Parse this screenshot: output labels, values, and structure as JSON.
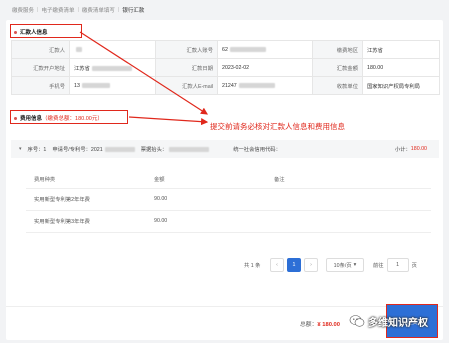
{
  "breadcrumb": [
    "缴费服务",
    "电子缴费清单",
    "缴费清单填写",
    "银行汇款"
  ],
  "remitter_section": {
    "title": "汇款人信息"
  },
  "remitter_rows": [
    [
      {
        "label": "汇款人",
        "value": ""
      },
      {
        "label": "汇款人账号",
        "value": "62"
      },
      {
        "label": "缴费地区",
        "value": "江苏省"
      }
    ],
    [
      {
        "label": "汇款开户地址",
        "value": "江苏省"
      },
      {
        "label": "汇款日期",
        "value": "2023-02-02"
      },
      {
        "label": "汇款金额",
        "value": "180.00"
      }
    ],
    [
      {
        "label": "手机号",
        "value": "13"
      },
      {
        "label": "汇款人E-mail",
        "value": "21247"
      },
      {
        "label": "收款单位",
        "value": "国家知识产权局专利局"
      }
    ]
  ],
  "fee_section": {
    "title": "费用信息",
    "total_note": "（缴费总额：180.00元）"
  },
  "annotation": "提交前请务必核对汇款人信息和费用信息",
  "item": {
    "caret": "▾",
    "seq": "序号：1",
    "app_no": "申请号/专利号：2021",
    "payer_label": "票据抬头：",
    "credit_code_label": "统一社会信用代码：",
    "subtotal_label": "小计：",
    "subtotal_value": "180.00"
  },
  "fee_table": {
    "headers": [
      "费用种类",
      "金额",
      "备注"
    ],
    "rows": [
      {
        "kind": "实用新型专利第2年年费",
        "amount": "90.00",
        "note": ""
      },
      {
        "kind": "实用新型专利第3年年费",
        "amount": "90.00",
        "note": ""
      }
    ]
  },
  "pagination": {
    "total": "共 1 条",
    "prev": "‹",
    "page": "1",
    "next": "›",
    "page_size": "10条/页",
    "page_size_caret": "▾",
    "goto_label": "前往",
    "goto_value": "1",
    "goto_unit": "页"
  },
  "footer": {
    "total_label": "总额：",
    "total_value": "¥ 180.00",
    "submit_label": "提交"
  },
  "watermark": {
    "text": "多维知识产权"
  },
  "colors": {
    "accent": "#2d6fd6",
    "alert": "#e0281c"
  }
}
